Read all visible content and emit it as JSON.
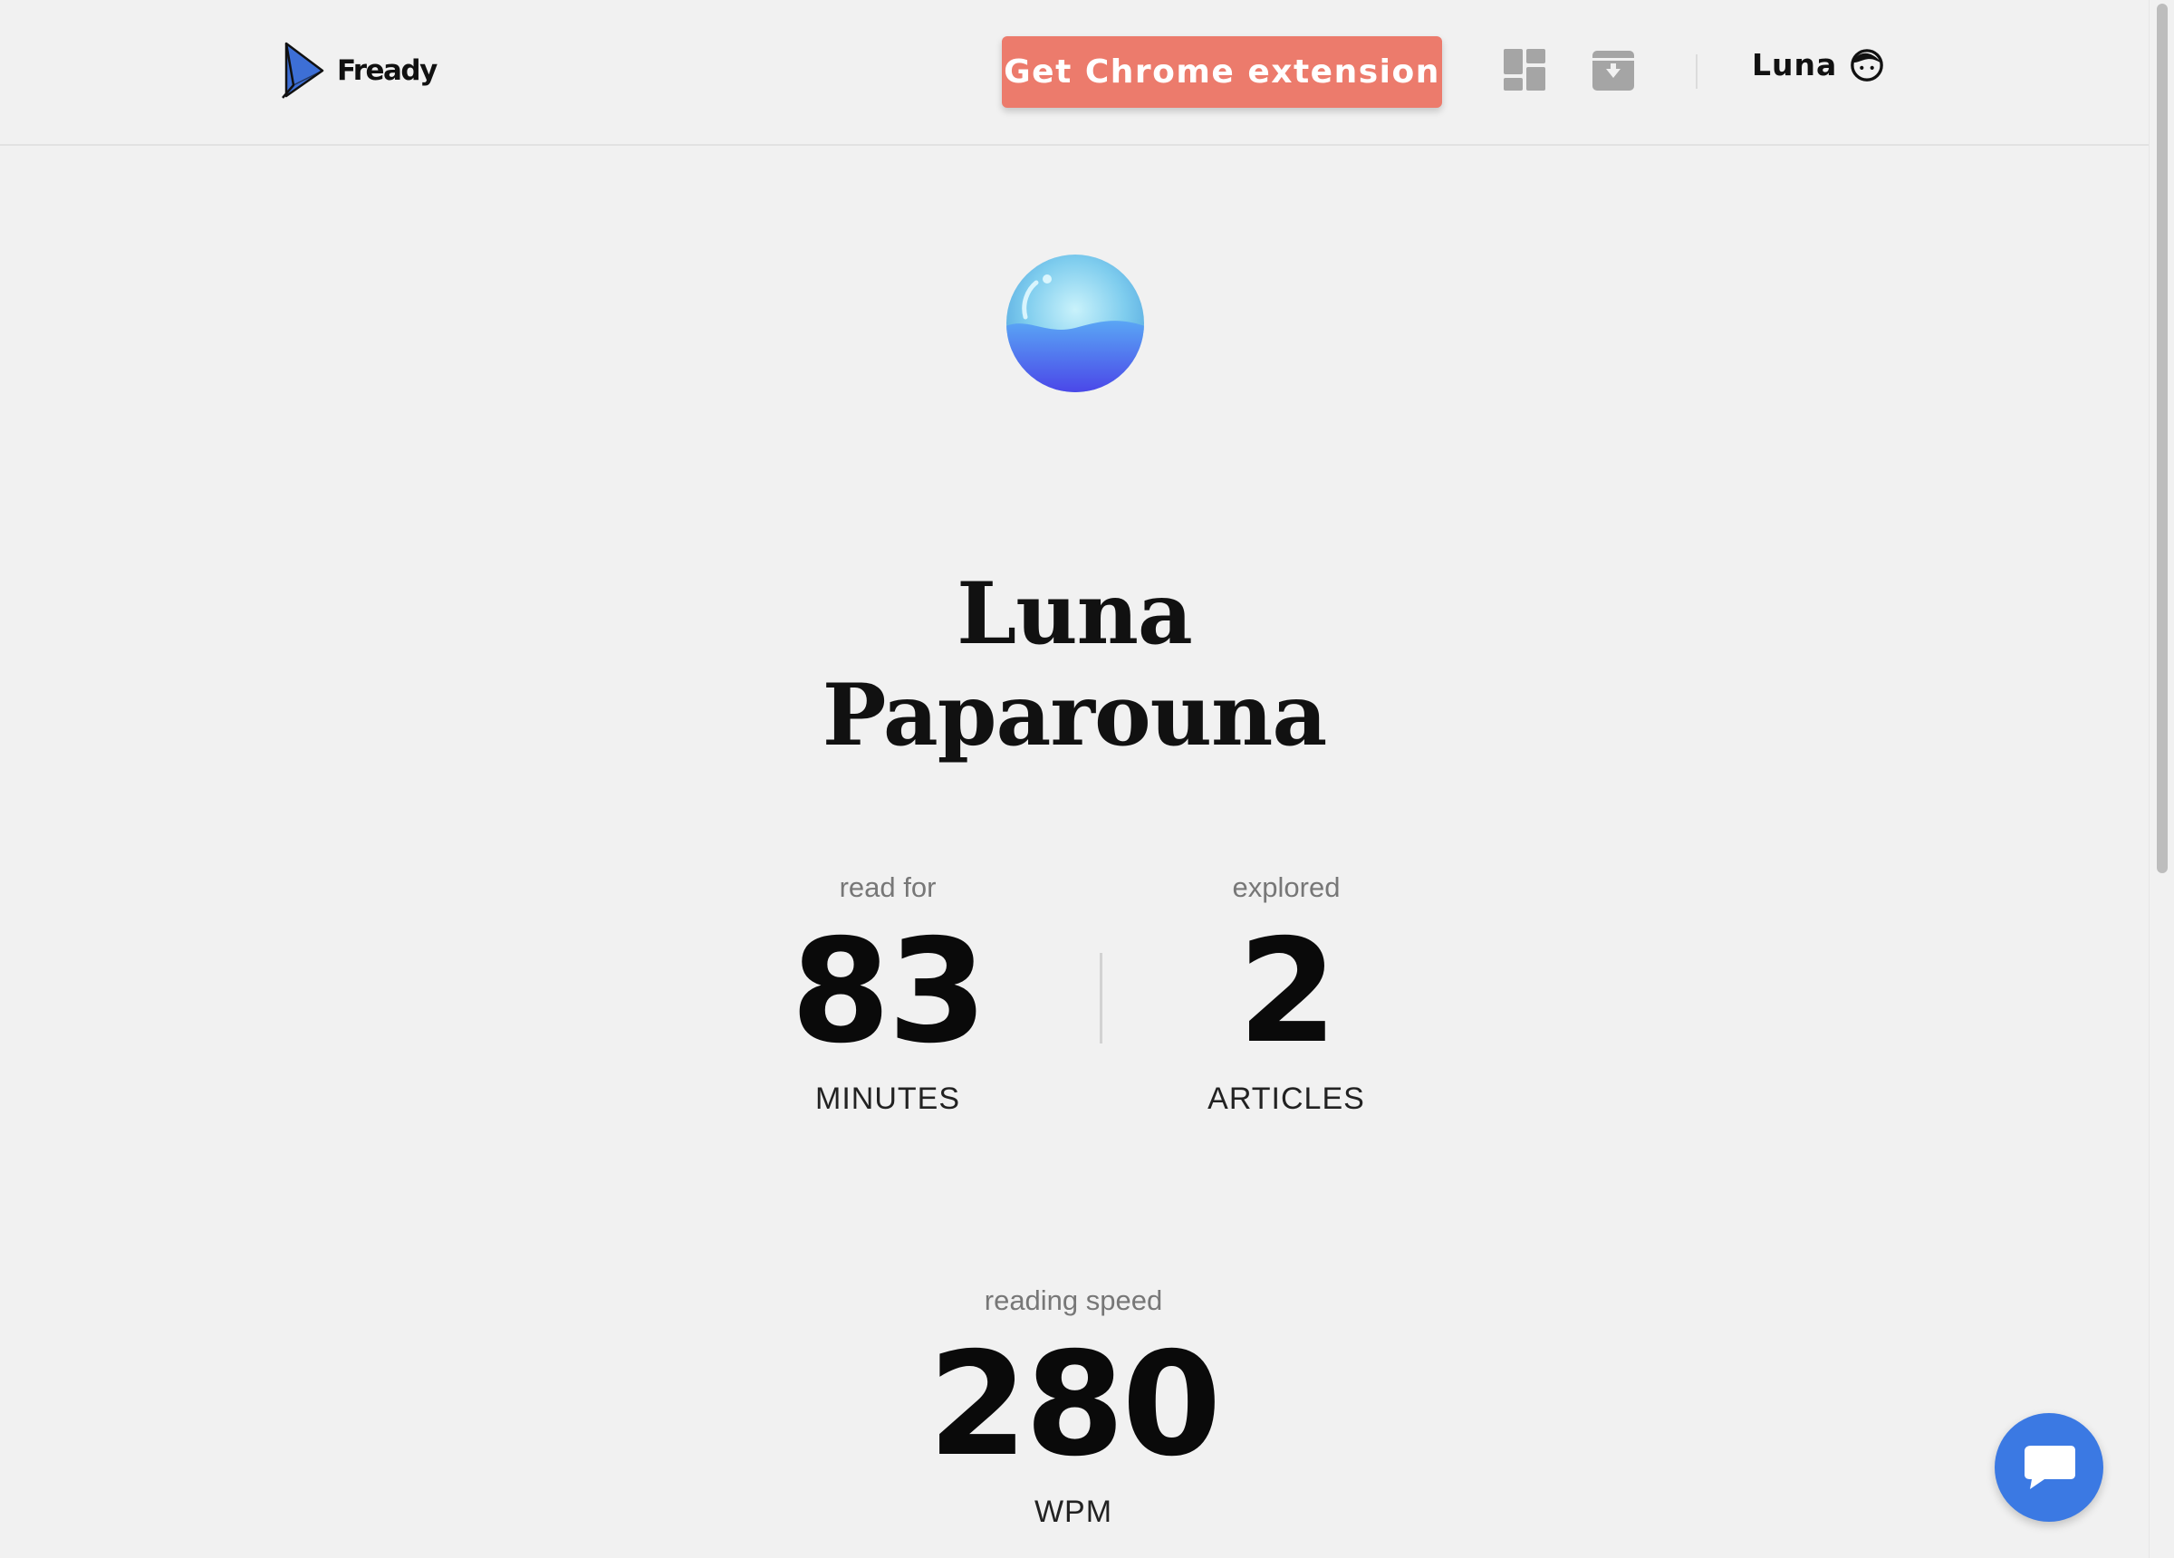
{
  "header": {
    "logo_text": "Fready",
    "cta_label": "Get Chrome extension",
    "user_name": "Luna",
    "icons": [
      "dashboard-icon",
      "archive-download-icon",
      "face-icon"
    ]
  },
  "profile": {
    "first_name": "Luna",
    "last_name": "Paparouna"
  },
  "stats": {
    "minutes": {
      "caption": "read for",
      "value": "83",
      "unit": "MINUTES"
    },
    "articles": {
      "caption": "explored",
      "value": "2",
      "unit": "ARTICLES"
    },
    "speed": {
      "caption": "reading speed",
      "value": "280",
      "unit": "WPM"
    }
  },
  "colors": {
    "accent": "#ec7b6c",
    "chat": "#3b79e3",
    "background": "#f1f1f1",
    "logo_blue": "#3d6fd6"
  }
}
